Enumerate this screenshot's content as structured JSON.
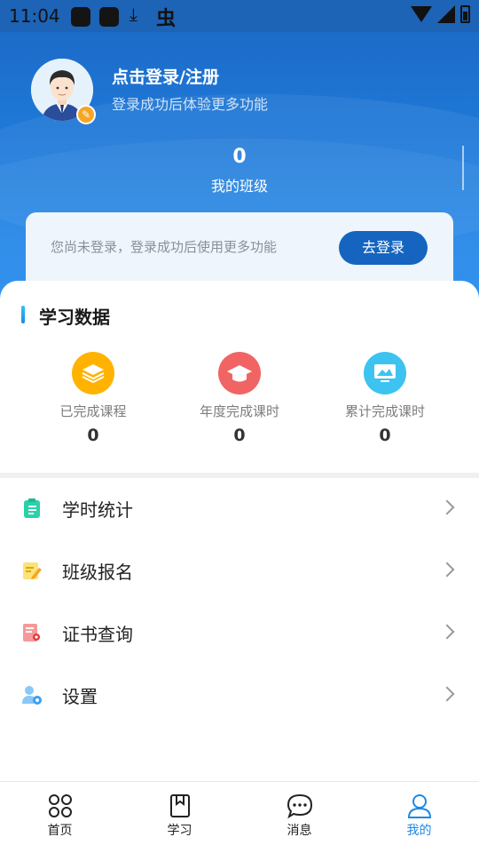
{
  "status_bar": {
    "time": "11:04",
    "icons": [
      "app-icon",
      "app-icon",
      "download-icon",
      "bug-icon",
      "wifi-icon",
      "signal-icon",
      "battery-icon"
    ]
  },
  "header": {
    "login_title": "点击登录/注册",
    "login_subtitle": "登录成功后体验更多功能",
    "class_count": "0",
    "class_label": "我的班级"
  },
  "notice": {
    "text": "您尚未登录，登录成功后使用更多功能",
    "button_label": "去登录"
  },
  "study_data": {
    "title": "学习数据",
    "stats": [
      {
        "label": "已完成课程",
        "value": "0",
        "icon": "layers-icon",
        "color": "#ffb300"
      },
      {
        "label": "年度完成课时",
        "value": "0",
        "icon": "graduation-cap-icon",
        "color": "#f06464"
      },
      {
        "label": "累计完成课时",
        "value": "0",
        "icon": "monitor-icon",
        "color": "#3cc3f0"
      }
    ]
  },
  "menu": [
    {
      "label": "学时统计",
      "icon": "clipboard-icon",
      "color": "#2bd1a8"
    },
    {
      "label": "班级报名",
      "icon": "edit-note-icon",
      "color": "#f7c744"
    },
    {
      "label": "证书查询",
      "icon": "certificate-icon",
      "color": "#f06464"
    },
    {
      "label": "设置",
      "icon": "user-settings-icon",
      "color": "#3a9ff0"
    }
  ],
  "tabs": [
    {
      "label": "首页",
      "icon": "home-grid-icon",
      "active": false
    },
    {
      "label": "学习",
      "icon": "book-icon",
      "active": false
    },
    {
      "label": "消息",
      "icon": "chat-icon",
      "active": false
    },
    {
      "label": "我的",
      "icon": "user-icon",
      "active": true
    }
  ],
  "colors": {
    "header_blue": "#1c6bc9",
    "primary_button": "#1565c0",
    "active_tab": "#1e88e5"
  }
}
